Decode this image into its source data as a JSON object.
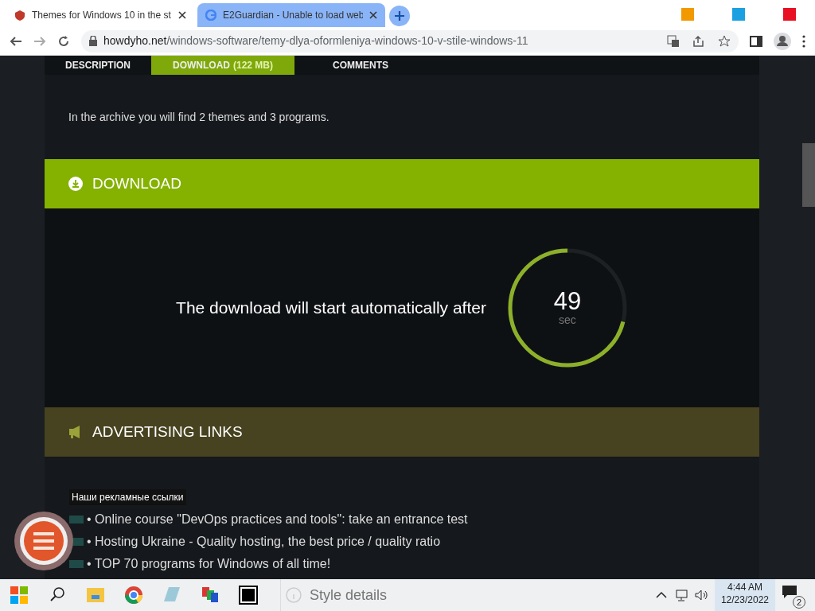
{
  "browser": {
    "tabs": [
      {
        "title": "Themes for Windows 10 in the st",
        "selected": false
      },
      {
        "title": "E2Guardian - Unable to load web",
        "selected": true
      }
    ],
    "url_host": "howdyho.net",
    "url_path": "/windows-software/temy-dlya-oformleniya-windows-10-v-stile-windows-11"
  },
  "page_tabs": [
    {
      "label": "DESCRIPTION",
      "selected": false
    },
    {
      "label": "DOWNLOAD",
      "size": "(122 MB)",
      "selected": true
    },
    {
      "label": "COMMENTS",
      "selected": false
    }
  ],
  "intro": "In the archive you will find 2 themes and 3 programs.",
  "download": {
    "title": "DOWNLOAD",
    "message": "The download will start automatically after",
    "count": "49",
    "unit": "sec",
    "level": 0.71
  },
  "ads": {
    "title": "ADVERTISING LINKS",
    "caption": "Наши рекламные ссылки",
    "links": [
      "• Online course \"DevOps practices and tools\": take an entrance test",
      "• Hosting Ukraine - Quality hosting, the best price / quality ratio",
      "• TOP 70 programs for Windows of all time!"
    ]
  },
  "taskbar": {
    "search_placeholder": "Style details",
    "time": "4:44 AM",
    "date": "12/23/2022",
    "notifications": "2"
  }
}
